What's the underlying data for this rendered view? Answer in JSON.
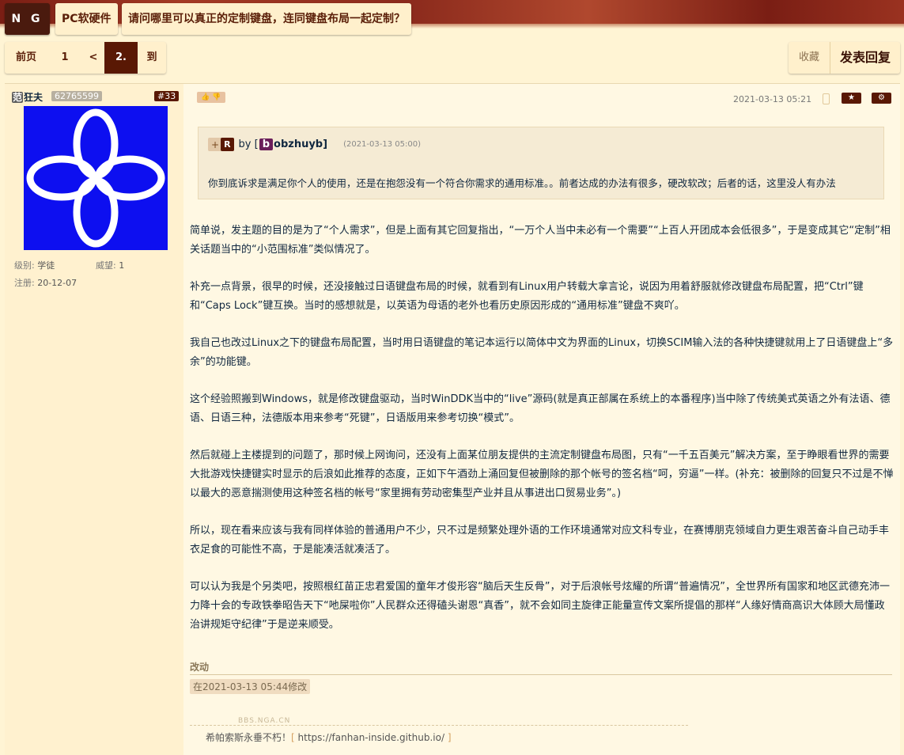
{
  "header": {
    "logo": "N G A",
    "forum": "PC软硬件",
    "thread_title": "请问哪里可以真正的定制键盘，连同键盘布局一起定制？"
  },
  "pager": {
    "prev": "前页",
    "first": "1",
    "back": "<",
    "current": "2.",
    "goto": "到"
  },
  "actions": {
    "favorite": "收藏",
    "reply": "发表回复"
  },
  "post": {
    "user": {
      "tag": "范",
      "name": "狂夫",
      "uid": "62765599",
      "level_label": "级别:",
      "level": "学徒",
      "rep_label": "威望:",
      "rep": "1",
      "reg_label": "注册:",
      "reg_date": "20-12-07"
    },
    "floor": "#33",
    "vote_icons": "👍 👎",
    "time": "2021-03-13 05:21",
    "star": "★",
    "gear": "⚙",
    "quote": {
      "plus": "+",
      "badge": "R",
      "by": "by [",
      "author_initial": "b",
      "author_rest": "obzhuyb]",
      "time": "(2021-03-13 05:00)",
      "text": "你到底诉求是满足你个人的使用，还是在抱怨没有一个符合你需求的通用标准。。前者达成的办法有很多，硬改软改；后者的话，这里没人有办法"
    },
    "paragraphs": [
      "简单说，发主题的目的是为了“个人需求”，但是上面有其它回复指出，“一万个人当中未必有一个需要”“上百人开团成本会低很多”，于是变成其它“定制”相关话题当中的“小范围标准”类似情况了。",
      "补充一点背景，很早的时候，还没接触过日语键盘布局的时候，就看到有Linux用户转载大拿言论，说因为用着舒服就修改键盘布局配置，把“Ctrl”键和“Caps Lock”键互换。当时的感想就是，以英语为母语的老外也看历史原因形成的“通用标准”键盘不爽吖。",
      "我自己也改过Linux之下的键盘布局配置，当时用日语键盘的笔记本运行以简体中文为界面的Linux，切换SCIM输入法的各种快捷键就用上了日语键盘上“多余”的功能键。",
      "这个经验照搬到Windows，就是修改键盘驱动，当时WinDDK当中的“live”源码(就是真正部属在系统上的本番程序)当中除了传统美式英语之外有法语、德语、日语三种，法德版本用来参考“死键”，日语版用来参考切换“模式”。",
      "然后就碰上主楼提到的问题了，那时候上网询问，还没有上面某位朋友提供的主流定制键盘布局图，只有“一千五百美元”解决方案，至于睁眼看世界的需要大批游戏快捷键实时显示的后浪如此推荐的态度，正如下午酒劲上涌回复但被删除的那个帐号的签名档“呵，穷逼”一样。(补充：被删除的回复只不过是不惮以最大的恶意揣测使用这种签名档的帐号“家里拥有劳动密集型产业并且从事进出口贸易业务”。)",
      "所以，现在看来应该与我有同样体验的普通用户不少，只不过是频繁处理外语的工作环境通常对应文科专业，在赛博朋克领域自力更生艰苦奋斗自己动手丰衣足食的可能性不高，于是能凑活就凑活了。",
      "可以认为我是个另类吧，按照根红苗正忠君爱国的童年才俊形容“脑后天生反骨”，对于后浪帐号炫耀的所谓“普遍情况”，全世界所有国家和地区武德充沛一力降十会的专政铁拳昭告天下“吔屎啦你”人民群众还得磕头谢恩“真香”，就不会如同主旋律正能量宣传文案所提倡的那样“人缘好情商高识大体顾大局懂政治讲规矩守纪律”于是逆来顺受。"
    ],
    "edit_label": "改动",
    "edit_time": "在2021-03-13 05:44修改",
    "watermark": "BBS.NGA.CN",
    "signature": {
      "text": "希帕索斯永垂不朽！",
      "open": "[",
      "link": "https://fanhan-inside.github.io/",
      "close": "]"
    }
  }
}
